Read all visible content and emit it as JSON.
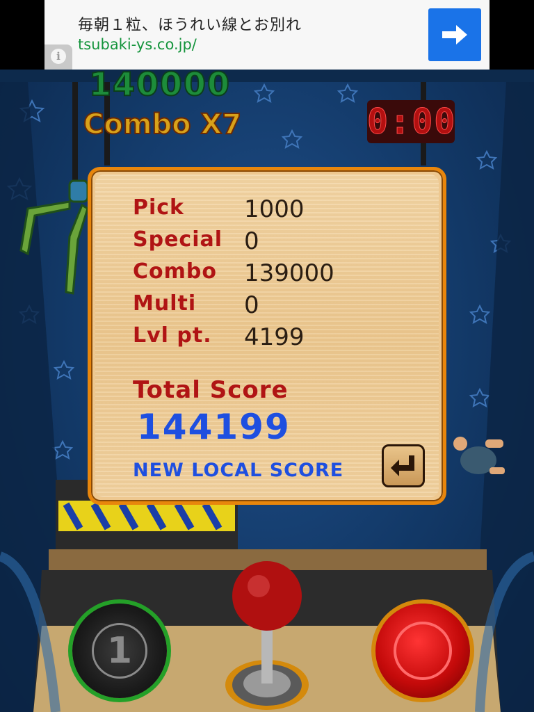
{
  "ad": {
    "title": "毎朝１粒、ほうれい線とお別れ",
    "url": "tsubaki-ys.co.jp/",
    "info_icon": "info-icon",
    "action_icon": "arrow-right-icon",
    "accent_color": "#1a73e8"
  },
  "hud": {
    "score": "140000",
    "combo": "Combo X7",
    "timer": "0:00"
  },
  "result": {
    "stats": [
      {
        "label": "Pick",
        "value": "1000"
      },
      {
        "label": "Special",
        "value": "0"
      },
      {
        "label": "Combo",
        "value": "139000"
      },
      {
        "label": "Multi",
        "value": "0"
      },
      {
        "label": "Lvl pt.",
        "value": "4199"
      }
    ],
    "total_label": "Total Score",
    "total_value": "144199",
    "new_local": "NEW LOCAL SCORE",
    "return_icon": "return-arrow-icon"
  },
  "controls": {
    "bomb_count": "1",
    "bomb_icon": "bomb-icon",
    "joystick_icon": "joystick-icon",
    "grab_icon": "red-button-icon"
  }
}
